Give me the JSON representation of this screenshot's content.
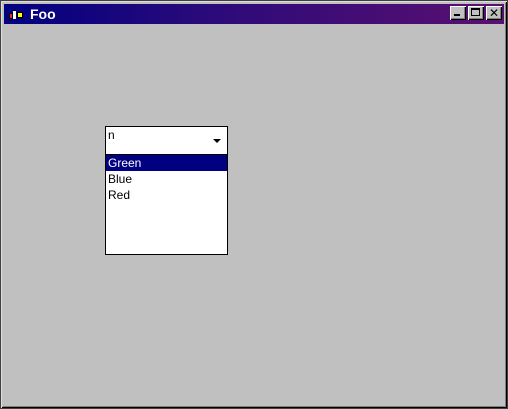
{
  "window": {
    "title": "Foo",
    "icon": "app-icon",
    "buttons": {
      "minimize": "minimize-icon",
      "maximize": "maximize-icon",
      "close": "close-icon"
    },
    "colors": {
      "titlebar_start": "#000080",
      "titlebar_end": "#5a1070",
      "face": "#c0c0c0"
    }
  },
  "combobox": {
    "value": "n",
    "arrow_icon": "dropdown-arrow-icon",
    "options": [
      {
        "label": "Green",
        "selected": true
      },
      {
        "label": "Blue",
        "selected": false
      },
      {
        "label": "Red",
        "selected": false
      }
    ],
    "selection_color": "#000080"
  }
}
